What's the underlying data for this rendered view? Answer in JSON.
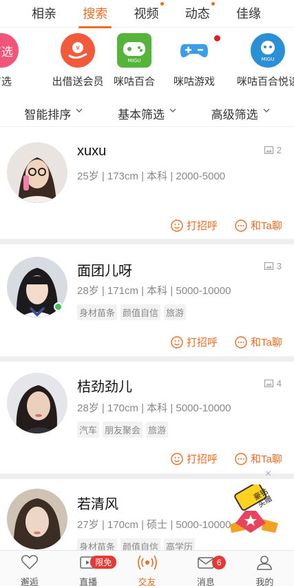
{
  "top_tabs": [
    {
      "label": "相亲",
      "active": false,
      "dot": false
    },
    {
      "label": "搜索",
      "active": true,
      "dot": false
    },
    {
      "label": "视频",
      "active": false,
      "dot": true
    },
    {
      "label": "动态",
      "active": false,
      "dot": true
    },
    {
      "label": "佳缘",
      "active": false,
      "dot": false
    }
  ],
  "apps": [
    {
      "label": "有选",
      "icon": "youxuan-icon"
    },
    {
      "label": "出借送会员",
      "icon": "yen-hand-icon"
    },
    {
      "label": "咪咕百合",
      "icon": "migu-game-icon"
    },
    {
      "label": "咪咕游戏",
      "icon": "gamepad-icon"
    },
    {
      "label": "咪咕百合悦读",
      "icon": "migu-read-icon"
    }
  ],
  "filters": [
    {
      "label": "智能排序"
    },
    {
      "label": "基本筛选"
    },
    {
      "label": "高级筛选"
    }
  ],
  "profiles": [
    {
      "name": "xuxu",
      "info": "25岁 | 173cm | 本科 | 2000-5000",
      "photos": "2",
      "tags": [],
      "online": false
    },
    {
      "name": "面团儿呀",
      "info": "28岁 | 171cm | 本科 | 5000-10000",
      "photos": "3",
      "tags": [
        "身材苗条",
        "颜值自信",
        "旅游"
      ],
      "online": true
    },
    {
      "name": "桔劲劲儿",
      "info": "28岁 | 170cm | 本科 | 5000-10000",
      "photos": "4",
      "tags": [
        "汽车",
        "朋友聚会",
        "旅游"
      ],
      "online": false
    },
    {
      "name": "若清风",
      "info": "27岁 | 170cm | 硕士 | 5000-10000",
      "photos": "",
      "tags": [
        "身材苗条",
        "颜值自信",
        "高学历"
      ],
      "online": false
    }
  ],
  "actions": {
    "greet": "打招呼",
    "chat": "和Ta聊"
  },
  "float_ad": {
    "line1": "豪钻",
    "line2": "买赠",
    "close": "×"
  },
  "bottom_nav": [
    {
      "label": "邂逅",
      "icon": "heart-icon",
      "active": false,
      "badge": ""
    },
    {
      "label": "直播",
      "icon": "live-video-icon",
      "active": false,
      "badge": "限免"
    },
    {
      "label": "交友",
      "icon": "broadcast-icon",
      "active": true,
      "badge": ""
    },
    {
      "label": "消息",
      "icon": "mail-icon",
      "active": false,
      "badge": "6"
    },
    {
      "label": "我的",
      "icon": "user-icon",
      "active": false,
      "badge": ""
    }
  ],
  "colors": {
    "accent": "#f26a1b",
    "online": "#3cc35e",
    "badge": "#e53935"
  }
}
